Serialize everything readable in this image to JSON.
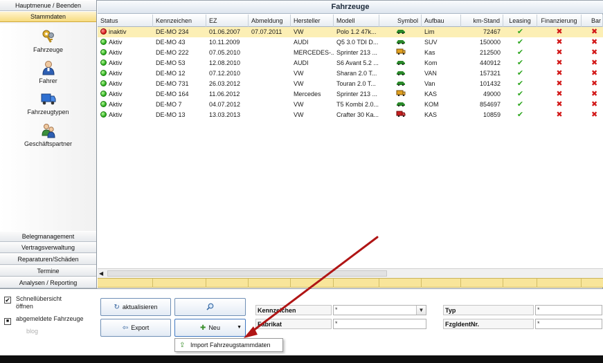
{
  "sidebar": {
    "top_buttons": [
      {
        "label": "Hauptmenue / Beenden",
        "active": false
      },
      {
        "label": "Stammdaten",
        "active": true
      }
    ],
    "items": [
      {
        "label": "Fahrzeuge",
        "icon": "keys-icon"
      },
      {
        "label": "Fahrer",
        "icon": "driver-icon"
      },
      {
        "label": "Fahrzeugtypen",
        "icon": "truck-icon"
      },
      {
        "label": "Geschäftspartner",
        "icon": "partner-icon"
      }
    ],
    "bottom_buttons": [
      {
        "label": "Belegmanagement"
      },
      {
        "label": "Vertragsverwaltung"
      },
      {
        "label": "Reparaturen/Schäden"
      },
      {
        "label": "Termine"
      },
      {
        "label": "Analysen / Reporting"
      }
    ]
  },
  "grid": {
    "title": "Fahrzeuge",
    "columns": [
      "Status",
      "Kennzeichen",
      "EZ",
      "Abmeldung",
      "Hersteller",
      "Modell",
      "Symbol",
      "Aufbau",
      "km-Stand",
      "Leasing",
      "Finanzierung",
      "Bar"
    ],
    "rows": [
      {
        "status": "inaktiv",
        "status_color": "red",
        "kennzeichen": "DE-MO 234",
        "ez": "01.06.2007",
        "abmeldung": "07.07.2011",
        "hersteller": "VW",
        "modell": "Polo 1.2 47k...",
        "symbol": "car-icon",
        "aufbau": "Lim",
        "km": "72467",
        "leasing": "✔",
        "finanzierung": "✖",
        "selected": true
      },
      {
        "status": "Aktiv",
        "status_color": "green",
        "kennzeichen": "DE-MO 43",
        "ez": "10.11.2009",
        "abmeldung": "",
        "hersteller": "AUDI",
        "modell": "Q5 3.0 TDI D...",
        "symbol": "car-icon",
        "aufbau": "SUV",
        "km": "150000",
        "leasing": "✔",
        "finanzierung": "✖",
        "selected": false
      },
      {
        "status": "Aktiv",
        "status_color": "green",
        "kennzeichen": "DE-MO 222",
        "ez": "07.05.2010",
        "abmeldung": "",
        "hersteller": "MERCEDES-...",
        "modell": "Sprinter 213 ...",
        "symbol": "van-icon",
        "aufbau": "Kas",
        "km": "212500",
        "leasing": "✔",
        "finanzierung": "✖",
        "selected": false
      },
      {
        "status": "Aktiv",
        "status_color": "green",
        "kennzeichen": "DE-MO 53",
        "ez": "12.08.2010",
        "abmeldung": "",
        "hersteller": "AUDI",
        "modell": "S6 Avant 5.2 ...",
        "symbol": "car-icon",
        "aufbau": "Kom",
        "km": "440912",
        "leasing": "✔",
        "finanzierung": "✖",
        "selected": false
      },
      {
        "status": "Aktiv",
        "status_color": "green",
        "kennzeichen": "DE-MO 12",
        "ez": "07.12.2010",
        "abmeldung": "",
        "hersteller": "VW",
        "modell": "Sharan 2.0 T...",
        "symbol": "car-icon",
        "aufbau": "VAN",
        "km": "157321",
        "leasing": "✔",
        "finanzierung": "✖",
        "selected": false
      },
      {
        "status": "Aktiv",
        "status_color": "green",
        "kennzeichen": "DE-MO 731",
        "ez": "26.03.2012",
        "abmeldung": "",
        "hersteller": "VW",
        "modell": "Touran 2.0 T...",
        "symbol": "car-icon",
        "aufbau": "Van",
        "km": "101432",
        "leasing": "✔",
        "finanzierung": "✖",
        "selected": false
      },
      {
        "status": "Aktiv",
        "status_color": "green",
        "kennzeichen": "DE-MO 164",
        "ez": "11.06.2012",
        "abmeldung": "",
        "hersteller": "Mercedes",
        "modell": "Sprinter 213 ...",
        "symbol": "van-icon",
        "aufbau": "KAS",
        "km": "49000",
        "leasing": "✔",
        "finanzierung": "✖",
        "selected": false
      },
      {
        "status": "Aktiv",
        "status_color": "green",
        "kennzeichen": "DE-MO 7",
        "ez": "04.07.2012",
        "abmeldung": "",
        "hersteller": "VW",
        "modell": "T5 Kombi 2.0...",
        "symbol": "car-icon",
        "aufbau": "KOM",
        "km": "854697",
        "leasing": "✔",
        "finanzierung": "✖",
        "selected": false
      },
      {
        "status": "Aktiv",
        "status_color": "green",
        "kennzeichen": "DE-MO 13",
        "ez": "13.03.2013",
        "abmeldung": "",
        "hersteller": "VW",
        "modell": "Crafter 30 Ka...",
        "symbol": "truck-small-icon",
        "aufbau": "KAS",
        "km": "10859",
        "leasing": "✔",
        "finanzierung": "✖",
        "selected": false
      }
    ]
  },
  "bottom": {
    "schnell_label_1": "Schnellübersicht",
    "schnell_label_2": "öffnen",
    "schnell_checked": "✔",
    "abgemeldet_label": "abgemeldete Fahrzeuge",
    "abgemeldet_checked": "■",
    "blog_label": "blog",
    "btn_aktualisieren": "aktualisieren",
    "btn_search_icon": "magnifier-icon",
    "btn_export": "Export",
    "btn_neu": "Neu",
    "dropdown_item": "Import Fahrzeugstammdaten",
    "filters": {
      "kennzeichen_label": "Kennzeichen",
      "kennzeichen_value": "*",
      "fabrikat_label": "Fabrikat",
      "fabrikat_value": "*",
      "typ_label": "Typ",
      "typ_value": "*",
      "fzgident_label": "FzgIdentNr.",
      "fzgident_value": "*"
    }
  },
  "colors": {
    "selected_row": "#fcefb5",
    "active_nav": "#f7dc7f",
    "annotation_arrow": "#b01515",
    "check": "#2ea61f",
    "cross": "#d21818"
  }
}
